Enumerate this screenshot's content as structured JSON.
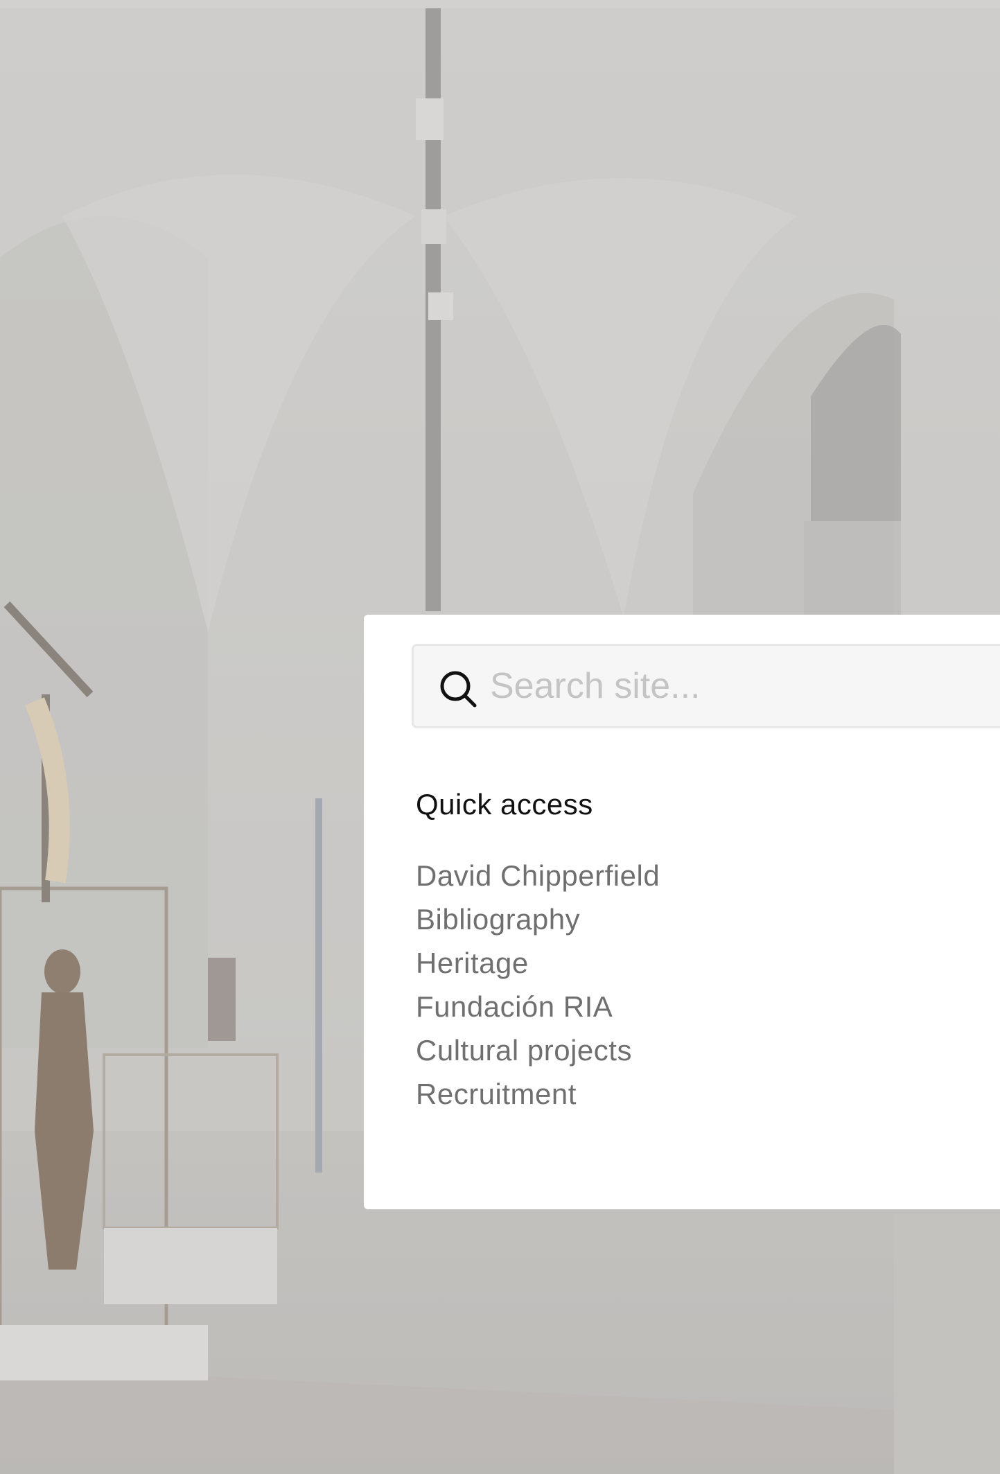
{
  "search": {
    "placeholder": "Search site..."
  },
  "quick_access": {
    "heading": "Quick access",
    "items": [
      {
        "label": "David Chipperfield"
      },
      {
        "label": "Bibliography"
      },
      {
        "label": "Heritage"
      },
      {
        "label": "Fundación RIA"
      },
      {
        "label": "Cultural projects"
      },
      {
        "label": "Recruitment"
      }
    ]
  },
  "colors": {
    "overlay": "#c9c8c6",
    "panel": "#ffffff",
    "search_bg": "#f6f6f6",
    "link": "#6f6f6f",
    "heading": "#111111"
  }
}
